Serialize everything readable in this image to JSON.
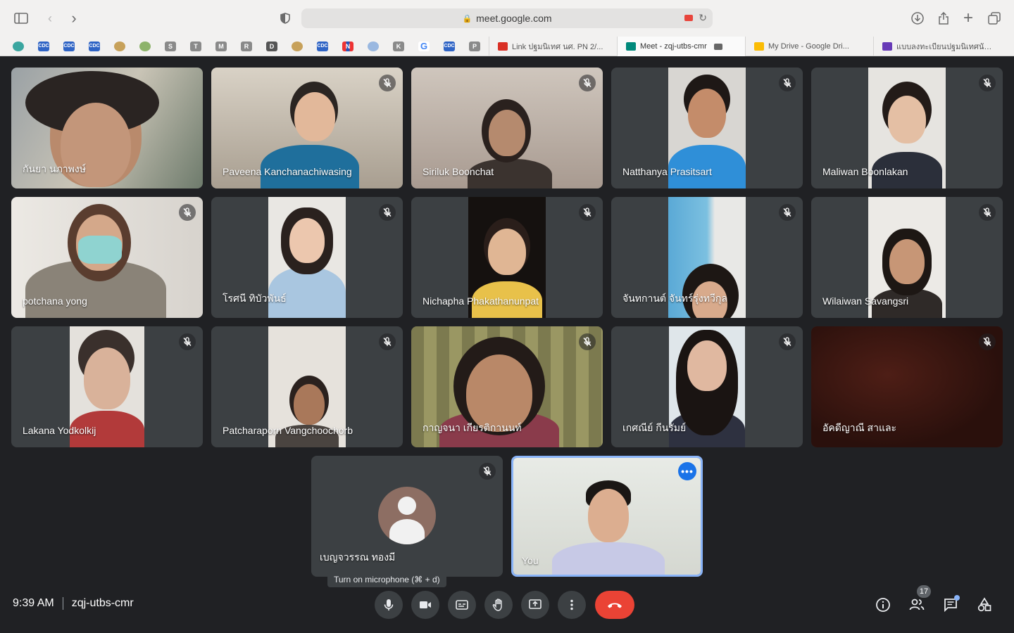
{
  "browser": {
    "url": "meet.google.com",
    "bookmarks": [
      {
        "label": "",
        "style": "teal"
      },
      {
        "label": "CDC",
        "style": "blue"
      },
      {
        "label": "CDC",
        "style": "blue"
      },
      {
        "label": "CDC",
        "style": "blue"
      },
      {
        "label": "",
        "style": "gold"
      },
      {
        "label": "",
        "style": "green"
      },
      {
        "label": "S",
        "style": ""
      },
      {
        "label": "T",
        "style": ""
      },
      {
        "label": "M",
        "style": ""
      },
      {
        "label": "R",
        "style": ""
      },
      {
        "label": "D",
        "style": "dark"
      },
      {
        "label": "",
        "style": "gold"
      },
      {
        "label": "CDC",
        "style": "blue"
      },
      {
        "label": "N",
        "style": "multi"
      },
      {
        "label": "",
        "style": "light"
      },
      {
        "label": "K",
        "style": ""
      },
      {
        "label": "G",
        "style": "gg"
      },
      {
        "label": "CDC",
        "style": "blue"
      },
      {
        "label": "P",
        "style": ""
      }
    ],
    "tabs": [
      {
        "title": "Link ปฐมนิเทศ นศ. PN 2/...",
        "fav_color": "#d93025",
        "active": false,
        "camera": false
      },
      {
        "title": "Meet - zqj-utbs-cmr",
        "fav_color": "#00897b",
        "active": true,
        "camera": true
      },
      {
        "title": "My Drive - Google Dri...",
        "fav_color": "#fbbc04",
        "active": false,
        "camera": false
      },
      {
        "title": "แบบลงทะเบียนปฐมนิเทศนัก...",
        "fav_color": "#673ab7",
        "active": false,
        "camera": false
      }
    ]
  },
  "meeting": {
    "time": "9:39 AM",
    "code": "zqj-utbs-cmr",
    "participant_count": "17",
    "tooltip": "Turn on microphone (⌘ + d)",
    "participants": [
      {
        "name": "กันยา นภาพงษ์",
        "muted": false
      },
      {
        "name": "Paveena Kanchanachiwasing",
        "muted": true
      },
      {
        "name": "Siriluk Boonchat",
        "muted": true
      },
      {
        "name": "Natthanya Prasitsart",
        "muted": true
      },
      {
        "name": "Maliwan Boonlakan",
        "muted": true
      },
      {
        "name": "potchana yong",
        "muted": true
      },
      {
        "name": "โรศนี ทิบัวพันธ์",
        "muted": true
      },
      {
        "name": "Nichapha Phakathanunpat",
        "muted": true
      },
      {
        "name": "จันทกานต์ จันทร์รุ่งทวีกุล",
        "muted": true
      },
      {
        "name": "Wilaiwan Savangsri",
        "muted": true
      },
      {
        "name": "Lakana Yodkolkij",
        "muted": true
      },
      {
        "name": "Patcharaporn Vangchoochorb",
        "muted": true
      },
      {
        "name": "กาญจนา เกียรติกานนท์",
        "muted": true
      },
      {
        "name": "เกศณีย์ กีนรัมย์",
        "muted": true
      },
      {
        "name": "อัคดีญาณี สาและ",
        "muted": true
      },
      {
        "name": "เบญจวรรณ ทองมี",
        "muted": true
      },
      {
        "name": "You",
        "muted": false
      }
    ]
  }
}
